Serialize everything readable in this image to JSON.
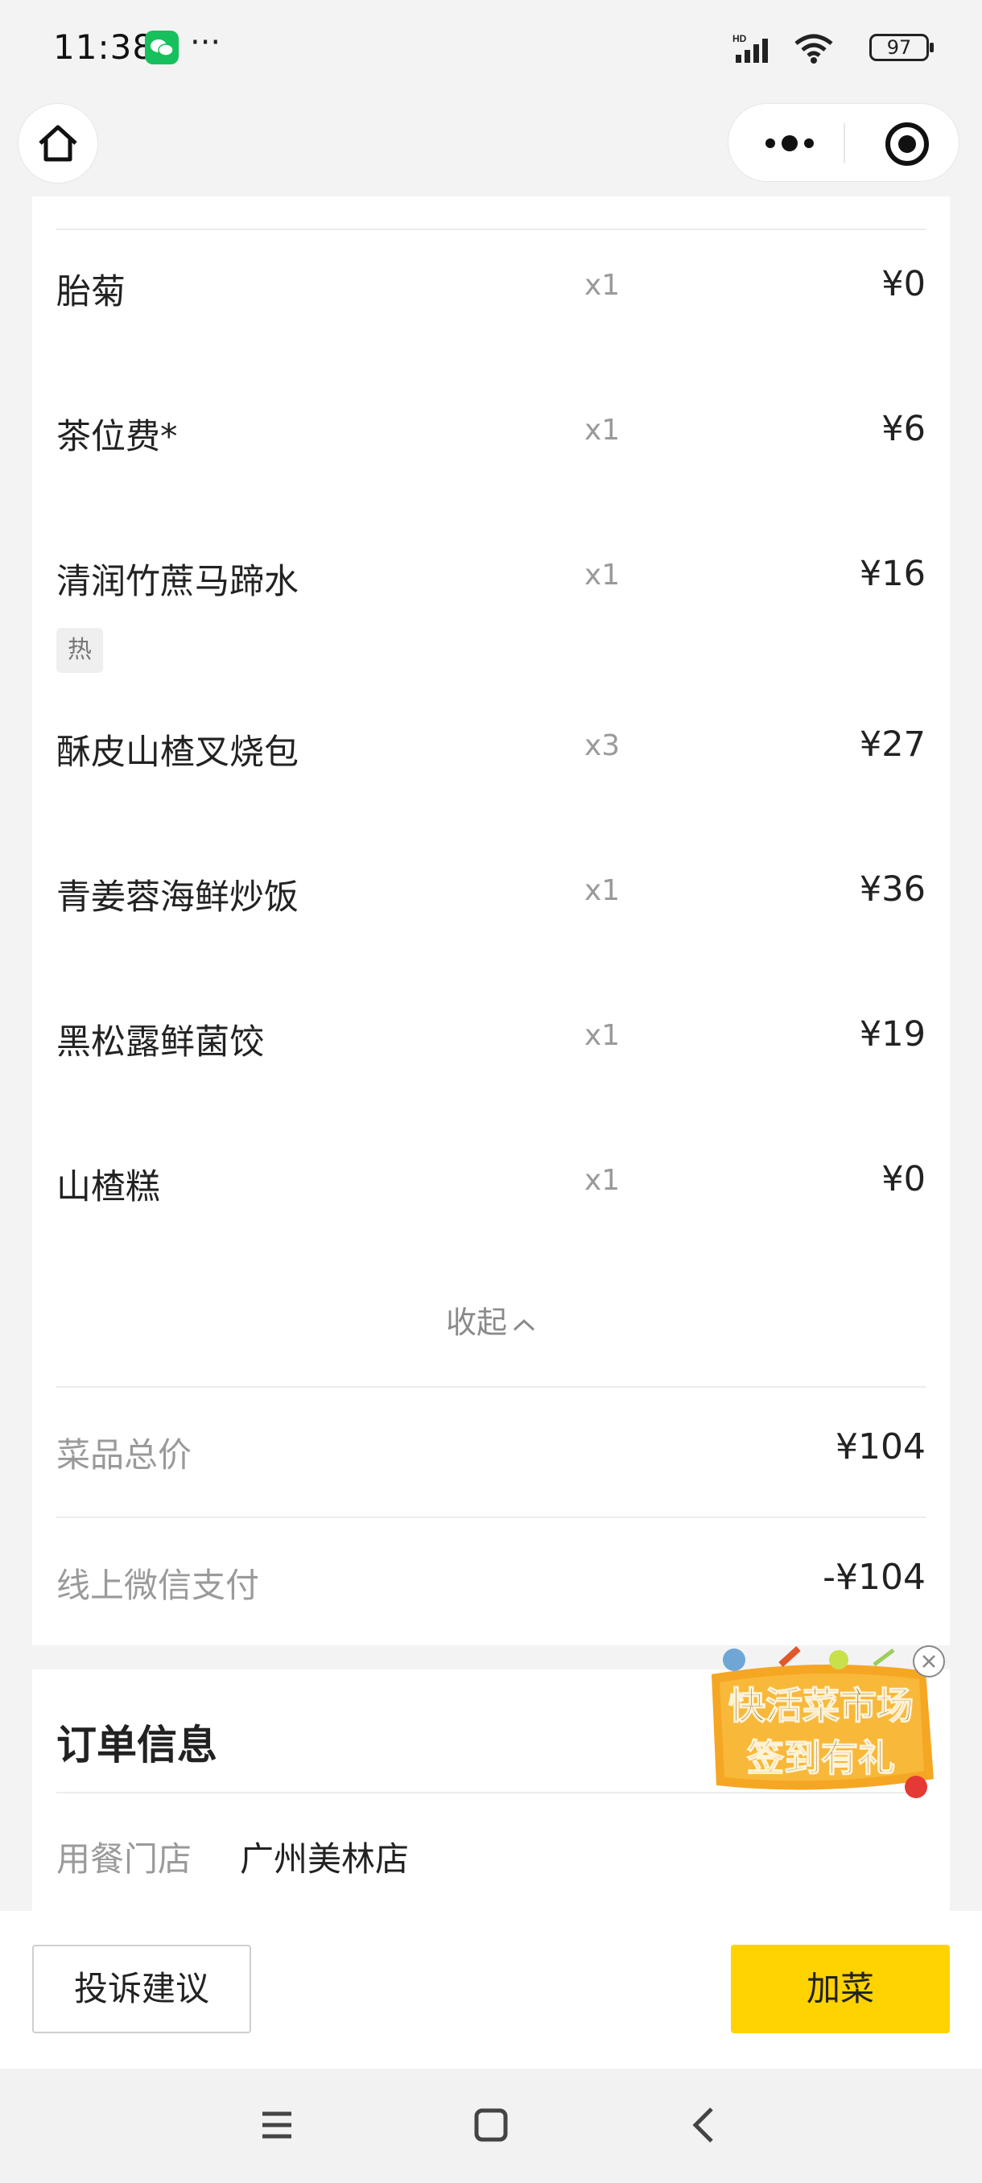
{
  "status_bar": {
    "time": "11:38",
    "dots": "···",
    "battery": "97",
    "icons": [
      "wechat-icon",
      "hd-signal-icon",
      "wifi-icon",
      "battery-icon"
    ]
  },
  "nav": {
    "icons": [
      "home-icon",
      "more-dots-icon",
      "close-target-icon"
    ]
  },
  "items": [
    {
      "name": "胎菊",
      "qty": "x1",
      "price": "¥0"
    },
    {
      "name": "茶位费*",
      "qty": "x1",
      "price": "¥6"
    },
    {
      "name": "清润竹蔗马蹄水",
      "qty": "x1",
      "price": "¥16",
      "tag": "热"
    },
    {
      "name": "酥皮山楂叉烧包",
      "qty": "x3",
      "price": "¥27"
    },
    {
      "name": "青姜蓉海鲜炒饭",
      "qty": "x1",
      "price": "¥36"
    },
    {
      "name": "黑松露鲜菌饺",
      "qty": "x1",
      "price": "¥19"
    },
    {
      "name": "山楂糕",
      "qty": "x1",
      "price": "¥0"
    }
  ],
  "collapse_label": "收起",
  "summary": {
    "total_label": "菜品总价",
    "total_value": "¥104",
    "paid_label": "线上微信支付",
    "paid_value": "-¥104"
  },
  "order_info": {
    "title": "订单信息",
    "store_label": "用餐门店",
    "store_value": "广州美林店"
  },
  "promo": {
    "line1": "快活菜市场",
    "line2": "签到有礼",
    "colors": {
      "badge": "#f5a623",
      "text": "#7a4a00"
    }
  },
  "actions": {
    "complain": "投诉建议",
    "add_dish": "加菜"
  },
  "colors": {
    "accent_yellow": "#ffd300",
    "wechat_green": "#16c05c"
  }
}
